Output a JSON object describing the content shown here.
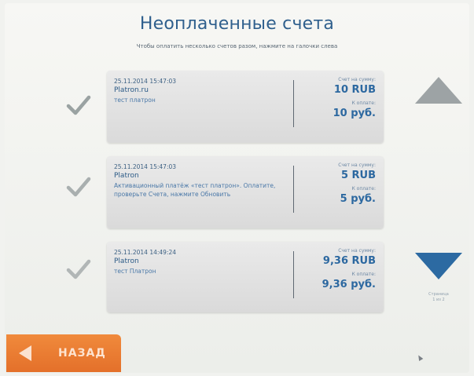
{
  "header": {
    "title": "Неоплаченные счета",
    "subtitle": "Чтобы оплатить несколько счетов разом, нажмите на галочки слева"
  },
  "invoices": [
    {
      "date": "25.11.2014 15:47:03",
      "merchant": "Platron.ru",
      "description": "тест платрон",
      "invoice_caption": "Счет на сумму:",
      "invoice_amount": "10 RUB",
      "pay_caption": "К оплате:",
      "pay_amount": "10 руб."
    },
    {
      "date": "25.11.2014 15:47:03",
      "merchant": "Platron",
      "description": "Активационный платёж «тест платрон». Оплатите, проверьте Счета, нажмите Обновить",
      "invoice_caption": "Счет на сумму:",
      "invoice_amount": "5 RUB",
      "pay_caption": "К оплате:",
      "pay_amount": "5 руб."
    },
    {
      "date": "25.11.2014 14:49:24",
      "merchant": "Platron",
      "description": "тест Платрон",
      "invoice_caption": "Счет на сумму:",
      "invoice_amount": "9,36 RUB",
      "pay_caption": "К оплате:",
      "pay_amount": "9,36 руб."
    }
  ],
  "pager": {
    "caption_line1": "Страница",
    "caption_line2": "1 из 2"
  },
  "back_button": {
    "label": "НАЗАД"
  },
  "icons": {
    "check": "check-icon",
    "scroll_up": "triangle-up-icon",
    "scroll_down": "triangle-down-icon",
    "back": "triangle-left-icon"
  },
  "colors": {
    "accent_blue": "#2c6aa2",
    "orange": "#e4702a",
    "check_gray": "#9aa2a2",
    "arrow_gray": "#9da3a5"
  }
}
